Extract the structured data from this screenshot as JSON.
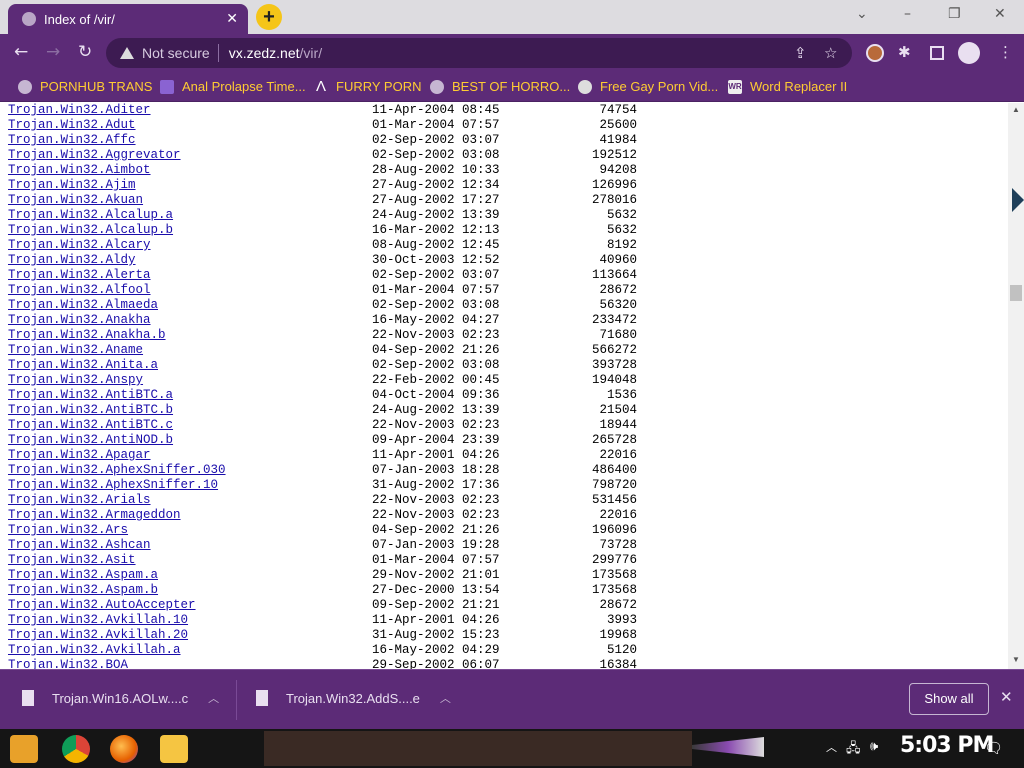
{
  "tab": {
    "title": "Index of /vir/",
    "close": "✕",
    "new_tab": "+"
  },
  "window_controls": {
    "minimize": "–",
    "restore": "❐",
    "close": "✕",
    "menu": "⌄"
  },
  "nav": {
    "back": "←",
    "forward": "→",
    "reload": "↻"
  },
  "omnibox": {
    "security_label": "Not secure",
    "host": "vx.zedz.net",
    "path": "/vir/"
  },
  "toolbar": {
    "share": "⇪",
    "star": "☆",
    "extensions": "✱",
    "menu": "⋮"
  },
  "bookmarks": [
    {
      "label": "PORNHUB TRANS",
      "icon": "globe-icon"
    },
    {
      "label": "Anal Prolapse Time...",
      "icon": "visual-studio-icon"
    },
    {
      "label": "FURRY PORN",
      "icon": "lambda-icon"
    },
    {
      "label": "BEST OF HORRO...",
      "icon": "globe-icon"
    },
    {
      "label": "Free Gay Porn Vid...",
      "icon": "site-icon"
    },
    {
      "label": "Word Replacer II",
      "icon": "wr-icon"
    }
  ],
  "listing": [
    {
      "name": "Trojan.Win32.Aditer",
      "date": "11-Apr-2004 08:45",
      "size": "74754"
    },
    {
      "name": "Trojan.Win32.Adut",
      "date": "01-Mar-2004 07:57",
      "size": "25600"
    },
    {
      "name": "Trojan.Win32.Affc",
      "date": "02-Sep-2002 03:07",
      "size": "41984"
    },
    {
      "name": "Trojan.Win32.Aggrevator",
      "date": "02-Sep-2002 03:08",
      "size": "192512"
    },
    {
      "name": "Trojan.Win32.Aimbot",
      "date": "28-Aug-2002 10:33",
      "size": "94208"
    },
    {
      "name": "Trojan.Win32.Ajim",
      "date": "27-Aug-2002 12:34",
      "size": "126996"
    },
    {
      "name": "Trojan.Win32.Akuan",
      "date": "27-Aug-2002 17:27",
      "size": "278016"
    },
    {
      "name": "Trojan.Win32.Alcalup.a",
      "date": "24-Aug-2002 13:39",
      "size": "5632"
    },
    {
      "name": "Trojan.Win32.Alcalup.b",
      "date": "16-Mar-2002 12:13",
      "size": "5632"
    },
    {
      "name": "Trojan.Win32.Alcary",
      "date": "08-Aug-2002 12:45",
      "size": "8192"
    },
    {
      "name": "Trojan.Win32.Aldy",
      "date": "30-Oct-2003 12:52",
      "size": "40960"
    },
    {
      "name": "Trojan.Win32.Alerta",
      "date": "02-Sep-2002 03:07",
      "size": "113664"
    },
    {
      "name": "Trojan.Win32.Alfool",
      "date": "01-Mar-2004 07:57",
      "size": "28672"
    },
    {
      "name": "Trojan.Win32.Almaeda",
      "date": "02-Sep-2002 03:08",
      "size": "56320"
    },
    {
      "name": "Trojan.Win32.Anakha",
      "date": "16-May-2002 04:27",
      "size": "233472"
    },
    {
      "name": "Trojan.Win32.Anakha.b",
      "date": "22-Nov-2003 02:23",
      "size": "71680"
    },
    {
      "name": "Trojan.Win32.Aname",
      "date": "04-Sep-2002 21:26",
      "size": "566272"
    },
    {
      "name": "Trojan.Win32.Anita.a",
      "date": "02-Sep-2002 03:08",
      "size": "393728"
    },
    {
      "name": "Trojan.Win32.Anspy",
      "date": "22-Feb-2002 00:45",
      "size": "194048"
    },
    {
      "name": "Trojan.Win32.AntiBTC.a",
      "date": "04-Oct-2004 09:36",
      "size": "1536"
    },
    {
      "name": "Trojan.Win32.AntiBTC.b",
      "date": "24-Aug-2002 13:39",
      "size": "21504"
    },
    {
      "name": "Trojan.Win32.AntiBTC.c",
      "date": "22-Nov-2003 02:23",
      "size": "18944"
    },
    {
      "name": "Trojan.Win32.AntiNOD.b",
      "date": "09-Apr-2004 23:39",
      "size": "265728"
    },
    {
      "name": "Trojan.Win32.Apagar",
      "date": "11-Apr-2001 04:26",
      "size": "22016"
    },
    {
      "name": "Trojan.Win32.AphexSniffer.030",
      "date": "07-Jan-2003 18:28",
      "size": "486400"
    },
    {
      "name": "Trojan.Win32.AphexSniffer.10",
      "date": "31-Aug-2002 17:36",
      "size": "798720"
    },
    {
      "name": "Trojan.Win32.Arials",
      "date": "22-Nov-2003 02:23",
      "size": "531456"
    },
    {
      "name": "Trojan.Win32.Armageddon",
      "date": "22-Nov-2003 02:23",
      "size": "22016"
    },
    {
      "name": "Trojan.Win32.Ars",
      "date": "04-Sep-2002 21:26",
      "size": "196096"
    },
    {
      "name": "Trojan.Win32.Ashcan",
      "date": "07-Jan-2003 19:28",
      "size": "73728"
    },
    {
      "name": "Trojan.Win32.Asit",
      "date": "01-Mar-2004 07:57",
      "size": "299776"
    },
    {
      "name": "Trojan.Win32.Aspam.a",
      "date": "29-Nov-2002 21:01",
      "size": "173568"
    },
    {
      "name": "Trojan.Win32.Aspam.b",
      "date": "27-Dec-2000 13:54",
      "size": "173568"
    },
    {
      "name": "Trojan.Win32.AutoAccepter",
      "date": "09-Sep-2002 21:21",
      "size": "28672"
    },
    {
      "name": "Trojan.Win32.Avkillah.10",
      "date": "11-Apr-2001 04:26",
      "size": "3993"
    },
    {
      "name": "Trojan.Win32.Avkillah.20",
      "date": "31-Aug-2002 15:23",
      "size": "19968"
    },
    {
      "name": "Trojan.Win32.Avkillah.a",
      "date": "16-May-2002 04:29",
      "size": "5120"
    },
    {
      "name": "Trojan.Win32.BOA",
      "date": "29-Sep-2002 06:07",
      "size": "16384"
    }
  ],
  "downloads": {
    "items": [
      {
        "label": "Trojan.Win16.AOLw....c",
        "chevron": "︿"
      },
      {
        "label": "Trojan.Win32.AddS....e",
        "chevron": "︿"
      }
    ],
    "show_all": "Show all",
    "close": "✕"
  },
  "taskbar": {
    "tray": {
      "chevron": "︿",
      "network": "🖧",
      "volume": "🕪",
      "notification": "🗨"
    },
    "clock": "5:03 PM"
  }
}
